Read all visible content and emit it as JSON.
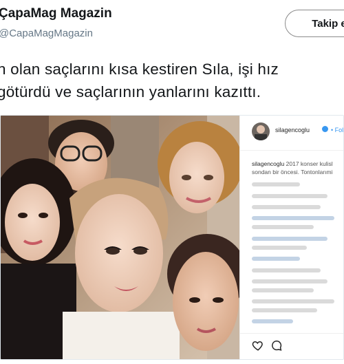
{
  "header": {
    "display_name": "ÇapaMag Magazin",
    "handle": "@CapaMagMagazin",
    "follow_label": "Takip et"
  },
  "tweet": {
    "line1": "n olan saçlarını kısa kestiren Sıla, işi hız",
    "line2": "götürdü ve saçlarının yanlarını kazıttı."
  },
  "instagram": {
    "username": "silagencoglu",
    "follow_label": "• Follow",
    "caption_user": "silagencoglu",
    "caption_line1": "2017 konser kulisl",
    "caption_line2": "sondan bir öncesi. Tontonlarımi"
  },
  "colors": {
    "link_blue": "#3897f0",
    "muted": "#657786"
  }
}
